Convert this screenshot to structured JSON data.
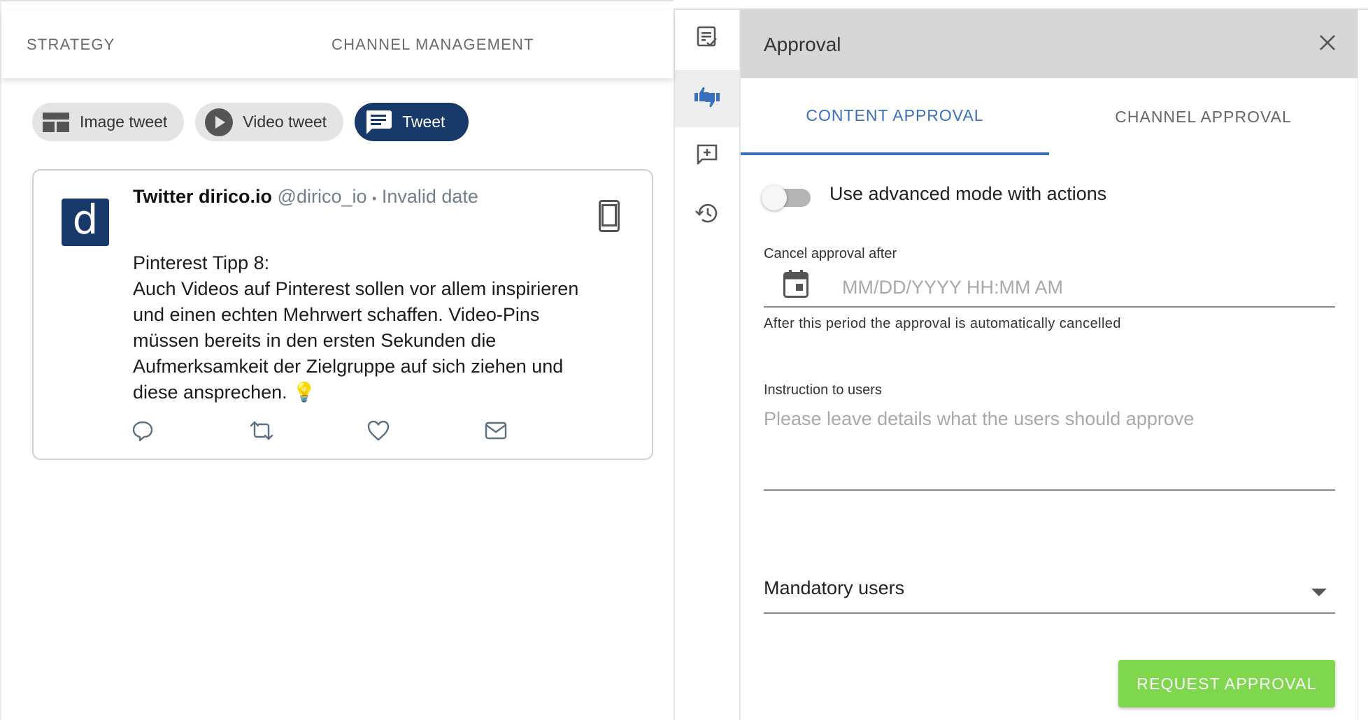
{
  "nav": {
    "tabs": [
      {
        "label": "STRATEGY"
      },
      {
        "label": "CHANNEL MANAGEMENT"
      }
    ]
  },
  "post_types": [
    {
      "label": "Image tweet",
      "icon": "image-layout-icon",
      "active": false
    },
    {
      "label": "Video tweet",
      "icon": "play-circle-icon",
      "active": false
    },
    {
      "label": "Tweet",
      "icon": "message-icon",
      "active": true
    }
  ],
  "tweet": {
    "avatar_letter": "d",
    "account_name": "Twitter dirico.io",
    "handle": "@dirico_io",
    "separator": "•",
    "date": "Invalid date",
    "text_lines": [
      "Pinterest Tipp 8:",
      "Auch Videos auf Pinterest sollen vor allem inspirieren",
      "und einen echten Mehrwert schaffen. Video-Pins",
      "müssen bereits in den ersten Sekunden die",
      "Aufmerksamkeit der Zielgruppe auf sich ziehen und",
      "diese ansprechen. 💡"
    ]
  },
  "approval": {
    "title": "Approval",
    "tabs": [
      {
        "label": "CONTENT APPROVAL",
        "active": true
      },
      {
        "label": "CHANNEL APPROVAL",
        "active": false
      }
    ],
    "advanced_mode_label": "Use advanced mode with actions",
    "advanced_mode_on": false,
    "cancel_label": "Cancel approval after",
    "date_placeholder": "MM/DD/YYYY HH:MM AM",
    "cancel_helper": "After this period the approval is automatically cancelled",
    "instruction_label": "Instruction to users",
    "instruction_placeholder": "Please leave details what the users should approve",
    "mandatory_users_label": "Mandatory users",
    "request_button": "REQUEST APPROVAL"
  },
  "colors": {
    "brand": "#173a6b",
    "accent_tab": "#3a6fbd",
    "approve_button": "#7fd74d"
  }
}
